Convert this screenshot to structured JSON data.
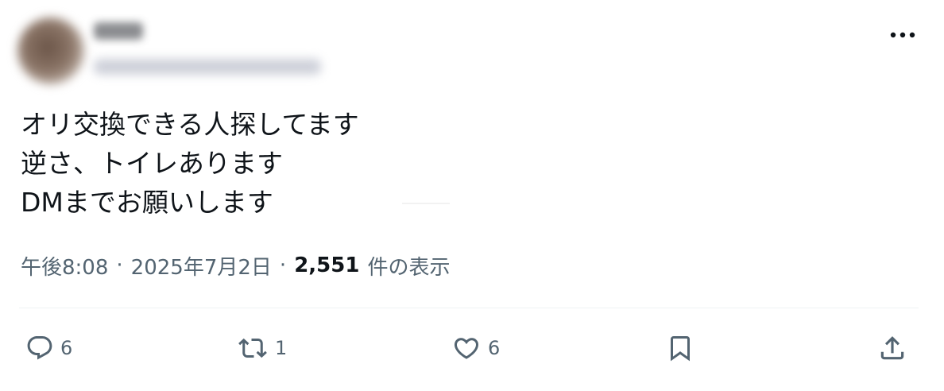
{
  "tweet": {
    "lines": [
      "オリ交換できる人探してます",
      "逆さ、トイレあります",
      "DMまでお願いします"
    ],
    "time": "午後8:08",
    "separator": "·",
    "date": "2025年7月2日",
    "views_count": "2,551",
    "views_label": "件の表示"
  },
  "actions": {
    "reply_count": "6",
    "retweet_count": "1",
    "like_count": "6"
  },
  "icons": {
    "more": "more-horizontal-icon",
    "reply": "reply-icon",
    "retweet": "retweet-icon",
    "like": "heart-icon",
    "bookmark": "bookmark-icon",
    "share": "share-icon"
  },
  "colors": {
    "text": "#0f1419",
    "secondary": "#536471",
    "divider": "#eff3f4"
  }
}
